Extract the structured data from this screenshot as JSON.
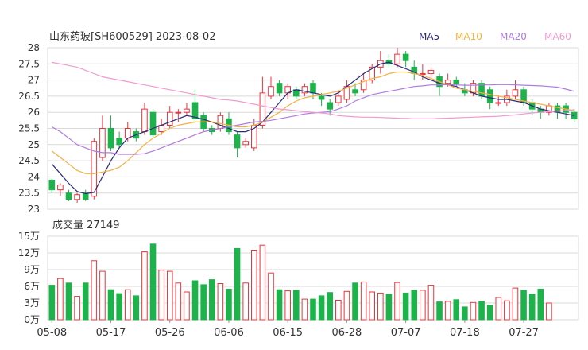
{
  "title": "山东药玻[SH600529] 2023-08-02",
  "ma_legend": [
    {
      "label": "MA5",
      "color": "#2b2b7a"
    },
    {
      "label": "MA10",
      "color": "#f5b041"
    },
    {
      "label": "MA20",
      "color": "#b07be0"
    },
    {
      "label": "MA60",
      "color": "#f09bd0"
    }
  ],
  "colors": {
    "up": "#e8333a",
    "down": "#1db34b",
    "grid": "#d9d9d9"
  },
  "volume_label": "成交量 27149",
  "price_axis": {
    "ylim": [
      23,
      28
    ],
    "ticks": [
      "28",
      "27.5",
      "27",
      "26.5",
      "26",
      "25.5",
      "25",
      "24.5",
      "24",
      "23.5",
      "23"
    ]
  },
  "volume_axis": {
    "ylim": [
      0,
      150000
    ],
    "ticks": [
      "15万",
      "12万",
      "9万",
      "6万",
      "3万",
      "0万"
    ]
  },
  "x_ticks": [
    {
      "label": "05-08",
      "index": 0
    },
    {
      "label": "05-17",
      "index": 7
    },
    {
      "label": "05-26",
      "index": 14
    },
    {
      "label": "06-06",
      "index": 21
    },
    {
      "label": "06-15",
      "index": 28
    },
    {
      "label": "06-28",
      "index": 35
    },
    {
      "label": "07-07",
      "index": 42
    },
    {
      "label": "07-18",
      "index": 49
    },
    {
      "label": "07-27",
      "index": 56
    }
  ],
  "chart_data": {
    "type": "candlestick",
    "candles": [
      [
        23.9,
        23.6,
        23.95,
        23.5
      ],
      [
        23.6,
        23.75,
        23.8,
        23.4
      ],
      [
        23.5,
        23.3,
        23.6,
        23.25
      ],
      [
        23.3,
        23.45,
        23.5,
        23.2
      ],
      [
        23.5,
        23.3,
        23.6,
        23.25
      ],
      [
        23.4,
        25.1,
        25.2,
        23.3
      ],
      [
        24.6,
        25.5,
        25.9,
        24.5
      ],
      [
        25.5,
        24.9,
        25.9,
        24.8
      ],
      [
        25.2,
        25.0,
        25.4,
        24.9
      ],
      [
        25.2,
        25.5,
        25.7,
        25.1
      ],
      [
        25.4,
        25.2,
        25.5,
        25.1
      ],
      [
        25.4,
        26.1,
        26.3,
        25.3
      ],
      [
        26.0,
        25.3,
        26.1,
        25.2
      ],
      [
        25.4,
        25.6,
        25.8,
        25.3
      ],
      [
        25.6,
        26.0,
        26.2,
        25.5
      ],
      [
        26.0,
        26.0,
        26.1,
        25.7
      ],
      [
        26.0,
        26.1,
        26.3,
        25.9
      ],
      [
        26.3,
        25.8,
        26.7,
        25.7
      ],
      [
        25.9,
        25.5,
        26.0,
        25.4
      ],
      [
        25.5,
        25.4,
        25.6,
        25.3
      ],
      [
        25.5,
        25.9,
        26.0,
        25.4
      ],
      [
        25.8,
        25.4,
        26.0,
        25.3
      ],
      [
        25.3,
        24.9,
        25.4,
        24.6
      ],
      [
        25.0,
        25.1,
        25.2,
        24.9
      ],
      [
        24.9,
        25.6,
        25.8,
        24.8
      ],
      [
        25.6,
        26.6,
        27.1,
        25.5
      ],
      [
        26.5,
        26.8,
        27.1,
        26.4
      ],
      [
        26.9,
        26.6,
        27.0,
        26.5
      ],
      [
        26.6,
        26.8,
        26.9,
        26.4
      ],
      [
        26.7,
        26.5,
        26.8,
        26.4
      ],
      [
        26.6,
        26.8,
        26.9,
        26.5
      ],
      [
        26.9,
        26.6,
        27.0,
        26.4
      ],
      [
        26.5,
        26.4,
        26.6,
        26.2
      ],
      [
        26.3,
        26.1,
        26.4,
        25.9
      ],
      [
        26.3,
        26.5,
        26.7,
        26.2
      ],
      [
        26.4,
        26.8,
        27.0,
        26.3
      ],
      [
        26.7,
        26.6,
        26.9,
        26.5
      ],
      [
        26.7,
        27.0,
        27.2,
        26.6
      ],
      [
        27.0,
        27.4,
        27.5,
        26.9
      ],
      [
        27.4,
        27.6,
        27.9,
        27.2
      ],
      [
        27.6,
        27.5,
        27.8,
        27.4
      ],
      [
        27.5,
        27.8,
        28.0,
        27.4
      ],
      [
        27.8,
        27.6,
        27.9,
        27.4
      ],
      [
        27.4,
        27.2,
        27.6,
        27.0
      ],
      [
        27.2,
        27.2,
        27.5,
        27.0
      ],
      [
        27.2,
        27.3,
        27.4,
        27.0
      ],
      [
        27.1,
        26.8,
        27.2,
        26.5
      ],
      [
        26.9,
        27.0,
        27.2,
        26.8
      ],
      [
        27.0,
        26.9,
        27.1,
        26.8
      ],
      [
        26.7,
        26.6,
        26.9,
        26.5
      ],
      [
        26.6,
        26.9,
        27.0,
        26.5
      ],
      [
        26.9,
        26.5,
        27.0,
        26.4
      ],
      [
        26.7,
        26.3,
        26.8,
        26.1
      ],
      [
        26.3,
        26.3,
        26.5,
        26.2
      ],
      [
        26.3,
        26.5,
        26.7,
        26.2
      ],
      [
        26.5,
        26.7,
        27.0,
        26.4
      ],
      [
        26.7,
        26.3,
        26.8,
        26.2
      ],
      [
        26.3,
        26.1,
        26.4,
        25.9
      ],
      [
        26.1,
        26.0,
        26.2,
        25.8
      ],
      [
        26.0,
        26.2,
        26.3,
        25.9
      ],
      [
        26.2,
        26.0,
        26.3,
        25.8
      ],
      [
        26.2,
        26.0,
        26.3,
        25.8
      ],
      [
        26.0,
        25.8,
        26.1,
        25.7
      ]
    ],
    "volume": [
      62000,
      74000,
      66000,
      42000,
      66000,
      106000,
      87000,
      54000,
      47000,
      54000,
      43000,
      122000,
      136000,
      89000,
      87000,
      66000,
      50000,
      70000,
      63000,
      72000,
      65000,
      55000,
      128000,
      66000,
      125000,
      134000,
      84000,
      54000,
      52000,
      53000,
      37000,
      37000,
      43000,
      49000,
      35000,
      51000,
      66000,
      68000,
      50000,
      48000,
      46000,
      67000,
      48000,
      53000,
      53000,
      62000,
      32000,
      33000,
      36000,
      23000,
      31000,
      33000,
      26000,
      40000,
      34000,
      57000,
      53000,
      46000,
      55000,
      30000
    ],
    "ma5": [
      24.4,
      24.1,
      23.8,
      23.55,
      23.48,
      23.52,
      24.0,
      24.5,
      24.9,
      25.2,
      25.3,
      25.4,
      25.5,
      25.6,
      25.7,
      25.8,
      25.9,
      25.85,
      25.78,
      25.7,
      25.6,
      25.5,
      25.4,
      25.4,
      25.5,
      25.7,
      26.0,
      26.3,
      26.6,
      26.7,
      26.65,
      26.6,
      26.55,
      26.5,
      26.6,
      26.8,
      27.0,
      27.2,
      27.35,
      27.5,
      27.55,
      27.45,
      27.35,
      27.25,
      27.1,
      27.0,
      26.9,
      26.85,
      26.8,
      26.7,
      26.6,
      26.5,
      26.45,
      26.4,
      26.4,
      26.35,
      26.3,
      26.2,
      26.1,
      26.05,
      26.0,
      25.95,
      25.9
    ],
    "ma10": [
      24.8,
      24.6,
      24.4,
      24.2,
      24.1,
      24.1,
      24.15,
      24.2,
      24.3,
      24.5,
      24.75,
      25.0,
      25.2,
      25.35,
      25.5,
      25.6,
      25.65,
      25.7,
      25.7,
      25.7,
      25.65,
      25.6,
      25.55,
      25.55,
      25.6,
      25.7,
      25.85,
      26.0,
      26.2,
      26.35,
      26.45,
      26.5,
      26.55,
      26.6,
      26.65,
      26.75,
      26.85,
      26.95,
      27.05,
      27.1,
      27.2,
      27.25,
      27.25,
      27.2,
      27.15,
      27.05,
      26.95,
      26.85,
      26.75,
      26.7,
      26.65,
      26.6,
      26.55,
      26.5,
      26.45,
      26.4,
      26.35,
      26.3,
      26.25,
      26.2,
      26.15,
      26.1,
      26.05
    ],
    "ma20": [
      25.55,
      25.4,
      25.2,
      25.0,
      24.9,
      24.8,
      24.75,
      24.75,
      24.7,
      24.7,
      24.7,
      24.72,
      24.8,
      24.9,
      25.0,
      25.1,
      25.2,
      25.3,
      25.4,
      25.45,
      25.5,
      25.55,
      25.6,
      25.65,
      25.7,
      25.72,
      25.75,
      25.8,
      25.85,
      25.9,
      25.95,
      25.98,
      26.0,
      26.02,
      26.1,
      26.2,
      26.35,
      26.45,
      26.55,
      26.6,
      26.65,
      26.7,
      26.75,
      26.8,
      26.82,
      26.85,
      26.85,
      26.86,
      26.85,
      26.84,
      26.84,
      26.85,
      26.85,
      26.86,
      26.86,
      26.85,
      26.84,
      26.83,
      26.82,
      26.8,
      26.78,
      26.72,
      26.65
    ],
    "ma60": [
      27.55,
      27.5,
      27.45,
      27.4,
      27.3,
      27.2,
      27.1,
      27.05,
      27.0,
      26.95,
      26.9,
      26.85,
      26.8,
      26.75,
      26.7,
      26.65,
      26.6,
      26.55,
      26.5,
      26.45,
      26.4,
      26.38,
      26.35,
      26.3,
      26.25,
      26.2,
      26.15,
      26.1,
      26.08,
      26.05,
      26.02,
      26.0,
      25.98,
      25.95,
      25.9,
      25.88,
      25.86,
      25.85,
      25.85,
      25.84,
      25.83,
      25.82,
      25.81,
      25.8,
      25.8,
      25.8,
      25.81,
      25.82,
      25.83,
      25.84,
      25.85,
      25.86,
      25.87,
      25.88,
      25.9,
      25.92,
      25.95,
      25.98,
      26.0,
      26.02,
      26.04,
      26.06,
      26.08
    ]
  }
}
